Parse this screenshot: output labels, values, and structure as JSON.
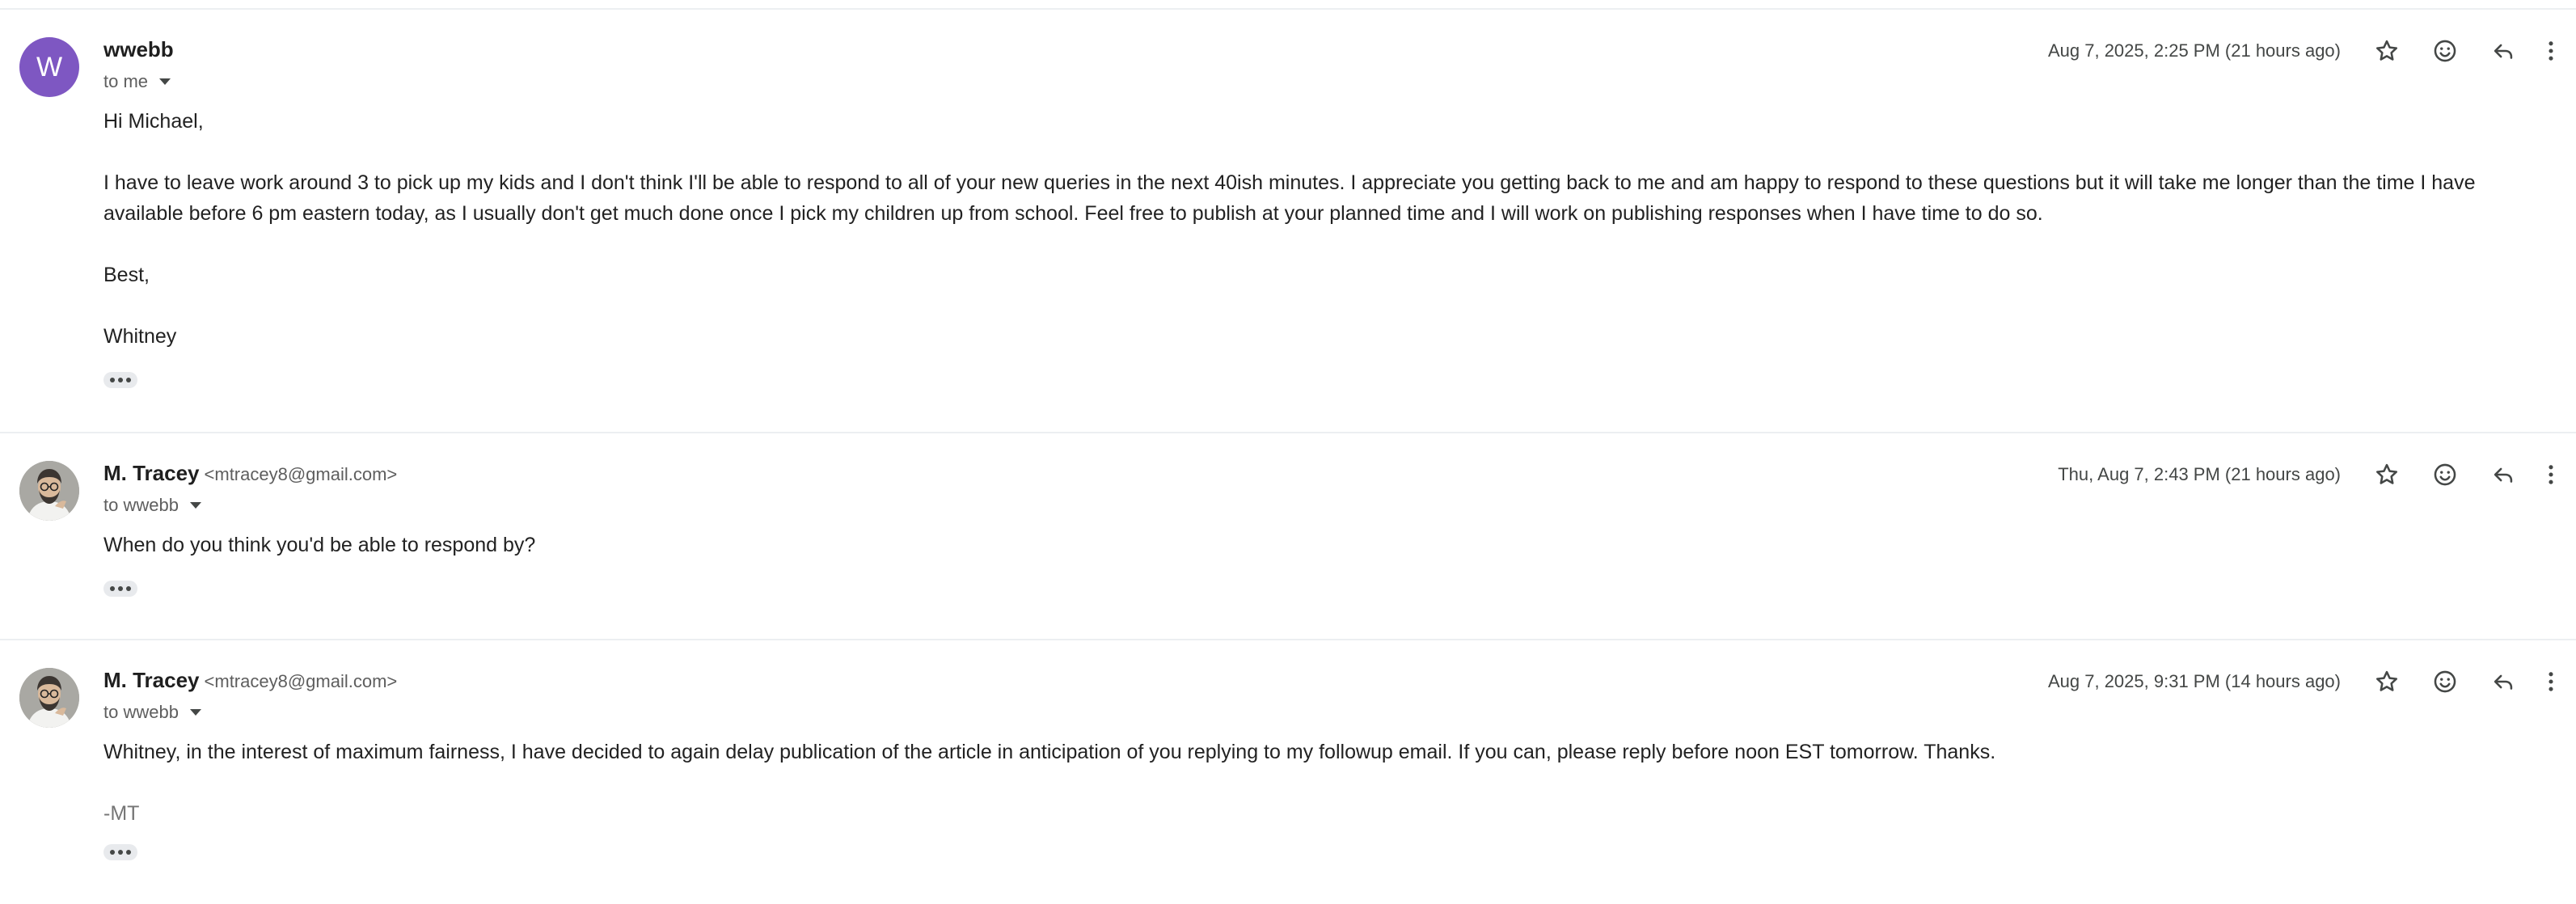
{
  "messages": [
    {
      "sender_name": "wwebb",
      "sender_email": "",
      "avatar_letter": "W",
      "recipient": "to me",
      "date": "Aug 7, 2025, 2:25 PM (21 hours ago)",
      "greeting": "Hi Michael,",
      "paragraph_1": "I have to leave work around 3 to pick up my kids and I don't think I'll be able to respond to all of your new queries in the next 40ish minutes. I appreciate you getting back to me and am happy to respond to these questions but it will take me longer than the time I have available before 6 pm eastern today, as I usually don't get much done once I pick my children up from school. Feel free to publish at your planned time and I will work on publishing responses when I have time to do so.",
      "closing": "Best,",
      "signature": "Whitney"
    },
    {
      "sender_name": "M. Tracey",
      "sender_email": "<mtracey8@gmail.com>",
      "recipient": "to wwebb",
      "date": "Thu, Aug 7, 2:43 PM (21 hours ago)",
      "paragraph_1": "When do you think you'd be able to respond by?"
    },
    {
      "sender_name": "M. Tracey",
      "sender_email": "<mtracey8@gmail.com>",
      "recipient": "to wwebb",
      "date": "Aug 7, 2025, 9:31 PM (14 hours ago)",
      "paragraph_1": "Whitney, in the interest of maximum fairness, I have decided to again delay publication of the article in anticipation of you replying to my followup email. If you can, please reply before noon EST tomorrow. Thanks.",
      "signature": "-MT"
    }
  ],
  "icons": {
    "star": "star-icon",
    "emoji": "emoji-icon",
    "reply": "reply-icon",
    "more": "more-vertical-icon",
    "details": "chevron-down-icon",
    "expand": "show-trimmed-content-icon"
  },
  "colors": {
    "avatar_purple": "#7e57c2",
    "divider": "#eceff1",
    "secondary_text": "#5e5e5e"
  }
}
